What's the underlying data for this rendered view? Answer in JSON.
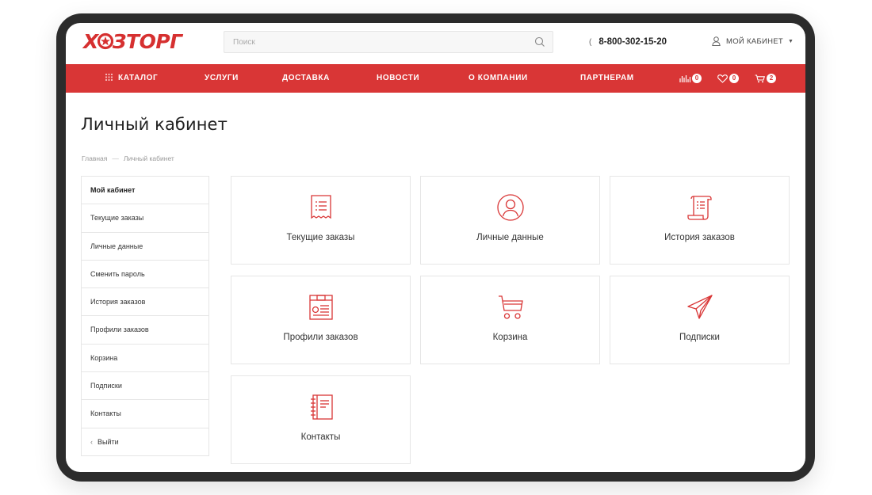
{
  "header": {
    "logo_text": "ХОЗТОРГ",
    "search_placeholder": "Поиск",
    "phone": "8-800-302-15-20",
    "account_label": "МОЙ КАБИНЕТ"
  },
  "nav": {
    "items": [
      "КАТАЛОГ",
      "УСЛУГИ",
      "ДОСТАВКА",
      "НОВОСТИ",
      "О КОМПАНИИ",
      "ПАРТНЕРАМ"
    ],
    "compare_count": "0",
    "favorites_count": "0",
    "cart_count": "2"
  },
  "page": {
    "title": "Личный кабинет",
    "breadcrumb": [
      "Главная",
      "Личный кабинет"
    ],
    "breadcrumb_sep": "—"
  },
  "sidebar": {
    "items": [
      "Мой кабинет",
      "Текущие заказы",
      "Личные данные",
      "Сменить пароль",
      "История заказов",
      "Профили заказов",
      "Корзина",
      "Подписки",
      "Контакты"
    ],
    "logout": "Выйти"
  },
  "cards": [
    {
      "label": "Текущие заказы",
      "icon": "receipt-icon"
    },
    {
      "label": "Личные данные",
      "icon": "user-icon"
    },
    {
      "label": "История заказов",
      "icon": "scroll-icon"
    },
    {
      "label": "Профили заказов",
      "icon": "profile-card-icon"
    },
    {
      "label": "Корзина",
      "icon": "cart-icon"
    },
    {
      "label": "Подписки",
      "icon": "paper-plane-icon"
    },
    {
      "label": "Контакты",
      "icon": "notebook-icon"
    }
  ],
  "colors": {
    "accent": "#d93636",
    "frame": "#2c2c2c",
    "border": "#e6e6e6"
  }
}
